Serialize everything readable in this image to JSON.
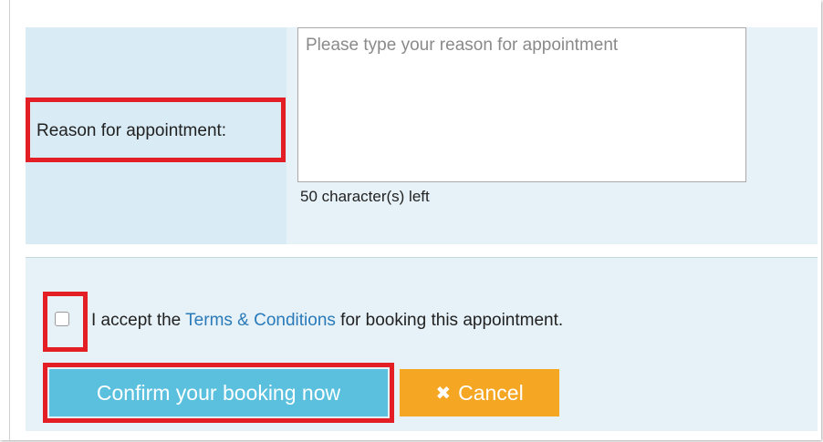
{
  "form": {
    "reason_label": "Reason for appointment:",
    "reason_placeholder": "Please type your reason for appointment",
    "reason_value": "",
    "char_count_text": "50 character(s) left"
  },
  "terms": {
    "prefix": "I accept the ",
    "link_text": "Terms & Conditions",
    "suffix": " for booking this appointment.",
    "checked": false
  },
  "buttons": {
    "confirm_label": "Confirm your booking now",
    "cancel_label": "Cancel",
    "cancel_icon": "close-icon"
  },
  "colors": {
    "panel_bg": "#e6f2f8",
    "label_cell_bg": "#d9ebf5",
    "link": "#2a7ab9",
    "confirm_bg": "#5bc0de",
    "cancel_bg": "#f5a623",
    "highlight": "#e31e24"
  }
}
